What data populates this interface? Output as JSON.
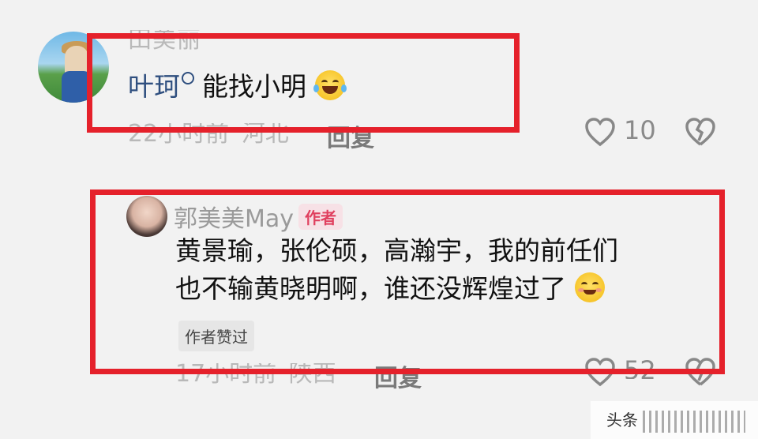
{
  "comments": [
    {
      "username": "田美丽",
      "mention": "叶珂",
      "text": "能找小明",
      "emoji": "laughing-tears-emoji",
      "time": "22小时前",
      "location": "河北",
      "reply_label": "回复",
      "likes": "10"
    },
    {
      "username": "郭美美May",
      "badge": "作者",
      "text_line1": "黄景瑜，张伦硕，高瀚宇，我的前任们",
      "text_line2": "也不输黄晓明啊，谁还没辉煌过了",
      "emoji": "smirk-emoji",
      "liked_by_author": "作者赞过",
      "time": "17小时前",
      "location": "陕西",
      "reply_label": "回复",
      "likes": "52"
    }
  ],
  "watermark": {
    "text": "头条"
  },
  "colors": {
    "highlight_box": "#e5212b",
    "mention": "#2f4f7f",
    "badge_text": "#e0405f",
    "badge_bg": "#f7e1e6"
  }
}
